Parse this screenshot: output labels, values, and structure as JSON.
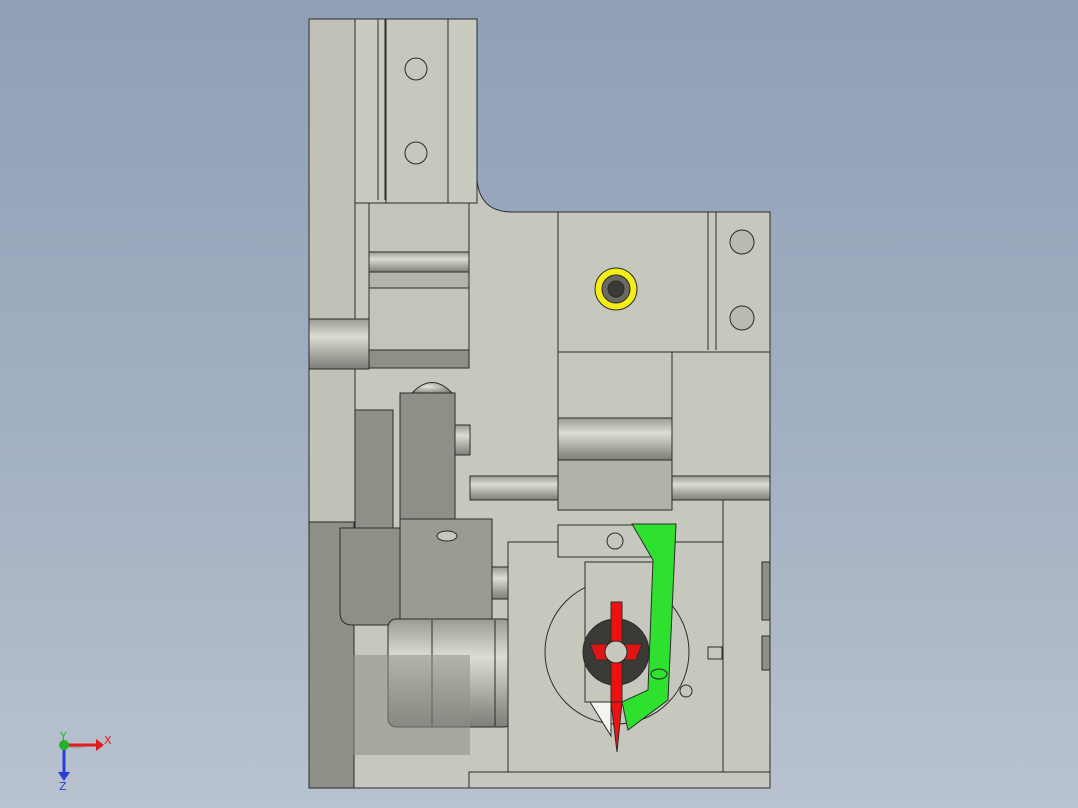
{
  "viewport": {
    "background_top": "#8fa0b6",
    "background_bottom": "#b9c2cf"
  },
  "colors": {
    "part_light": "#c6c8bd",
    "part_mid": "#b4b6ab",
    "part_dark": "#8e9088",
    "part_shadow": "#6f716b",
    "edge": "#2b2b2b",
    "highlight_green": "#2fe12f",
    "highlight_red": "#ee1111",
    "highlight_yellow": "#f4ee16"
  },
  "triad": {
    "x_label": "X",
    "y_label": "Y",
    "z_label": "Z",
    "x_color": "#e21b1b",
    "y_color": "#22b522",
    "z_color": "#2b3fd6"
  }
}
